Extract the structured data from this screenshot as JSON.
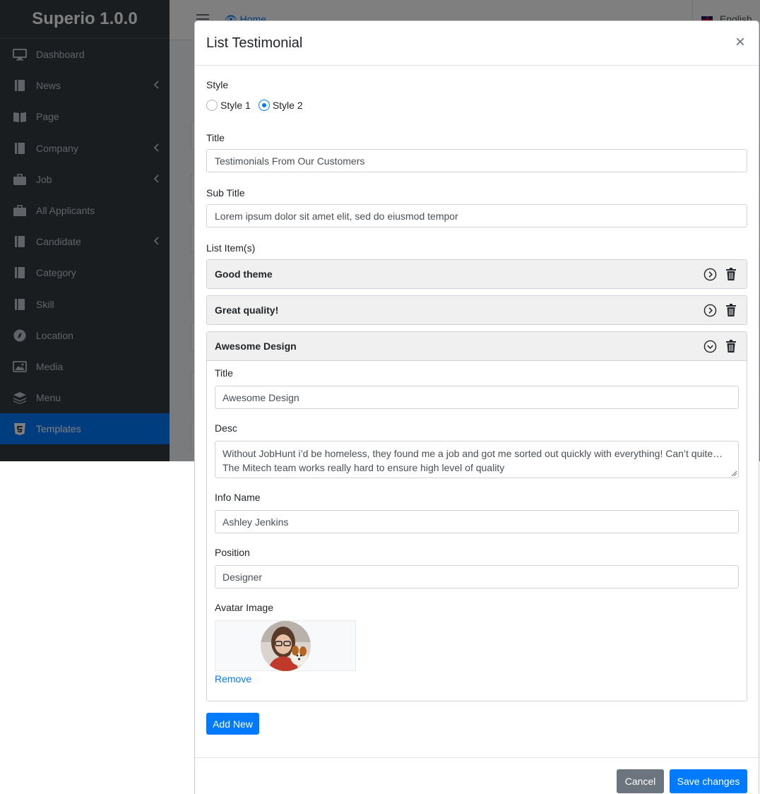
{
  "app": {
    "brand": "Superio 1.0.0"
  },
  "sidebar": {
    "items": [
      {
        "label": "Dashboard",
        "icon": "monitor-icon",
        "has_caret": false
      },
      {
        "label": "News",
        "icon": "book-icon",
        "has_caret": true
      },
      {
        "label": "Page",
        "icon": "book-open-icon",
        "has_caret": false
      },
      {
        "label": "Company",
        "icon": "book-icon",
        "has_caret": true
      },
      {
        "label": "Job",
        "icon": "briefcase-icon",
        "has_caret": true
      },
      {
        "label": "All Applicants",
        "icon": "briefcase-icon",
        "has_caret": false
      },
      {
        "label": "Candidate",
        "icon": "book-icon",
        "has_caret": true
      },
      {
        "label": "Category",
        "icon": "book-icon",
        "has_caret": false
      },
      {
        "label": "Skill",
        "icon": "book-icon",
        "has_caret": false
      },
      {
        "label": "Location",
        "icon": "compass-icon",
        "has_caret": false
      },
      {
        "label": "Media",
        "icon": "image-icon",
        "has_caret": false
      },
      {
        "label": "Menu",
        "icon": "layers-icon",
        "has_caret": false
      },
      {
        "label": "Templates",
        "icon": "html5-icon",
        "has_caret": false,
        "active": true
      }
    ]
  },
  "topbar": {
    "home_label": "Home",
    "language_label": "English"
  },
  "modal": {
    "title": "List Testimonial",
    "close_glyph": "×",
    "style": {
      "label": "Style",
      "options": [
        "Style 1",
        "Style 2"
      ],
      "selected": "Style 2"
    },
    "title_field": {
      "label": "Title",
      "value": "Testimonials From Our Customers"
    },
    "subtitle_field": {
      "label": "Sub Title",
      "value": "Lorem ipsum dolor sit amet elit, sed do eiusmod tempor"
    },
    "list_label": "List Item(s)",
    "items": [
      {
        "title": "Good theme",
        "expanded": false
      },
      {
        "title": "Great quality!",
        "expanded": false
      },
      {
        "title": "Awesome Design",
        "expanded": true
      }
    ],
    "expanded_item": {
      "title_label": "Title",
      "title_value": "Awesome Design",
      "desc_label": "Desc",
      "desc_line1": "Without JobHunt i’d be homeless, they found me a job and got me sorted out quickly with everything! Can’t quite…",
      "desc_line2": "The Mitech team works really hard to ensure high level of quality",
      "info_name_label": "Info Name",
      "info_name_value": "Ashley Jenkins",
      "position_label": "Position",
      "position_value": "Designer",
      "avatar_label": "Avatar Image",
      "remove_label": "Remove"
    },
    "add_new_label": "Add New",
    "footer": {
      "cancel_label": "Cancel",
      "save_label": "Save changes"
    }
  },
  "colors": {
    "primary": "#007bff",
    "secondary": "#6c757d",
    "sidebar": "#343a40"
  }
}
